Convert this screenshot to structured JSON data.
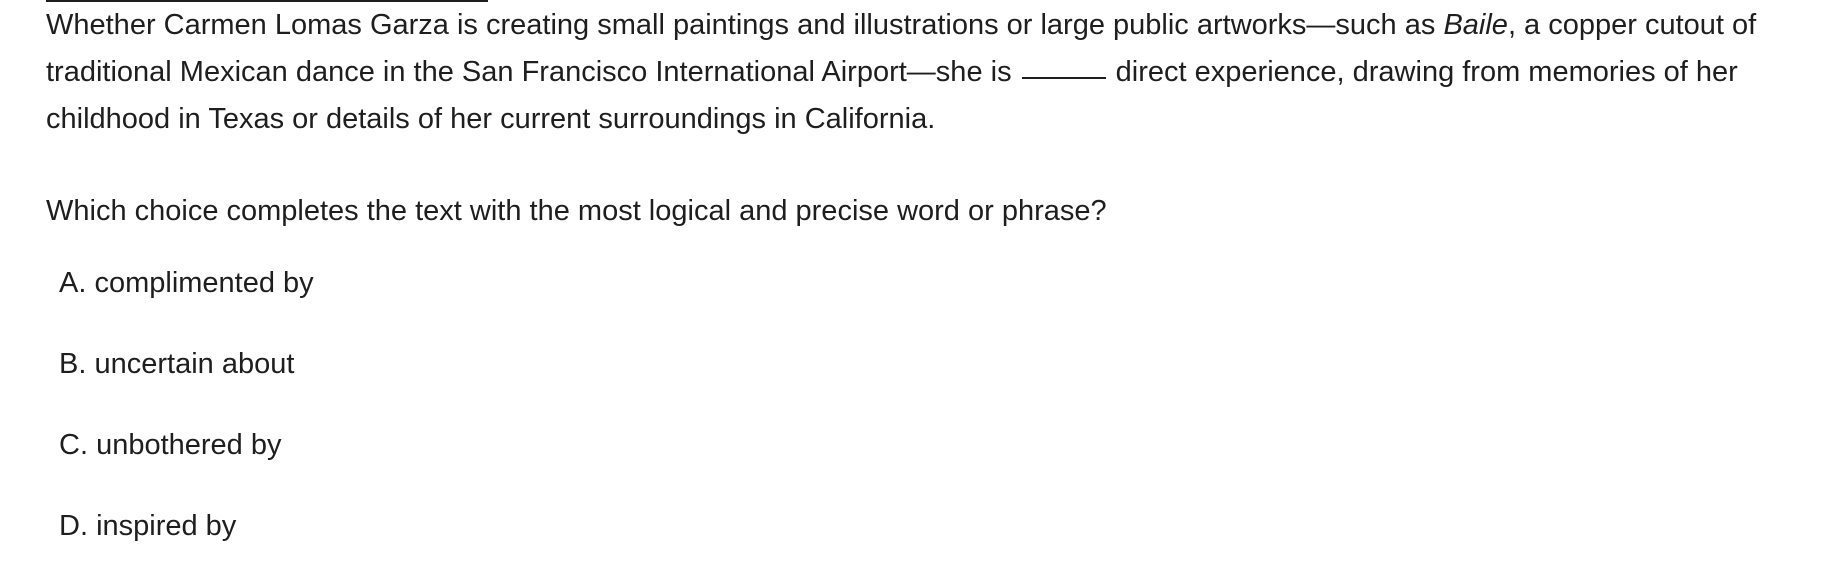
{
  "passage": {
    "part1": "Whether Carmen Lomas Garza is creating small paintings and illustrations or large public artworks—such as ",
    "title_italic": "Baile",
    "part2": ", a copper cutout of traditional Mexican dance in the San Francisco International Airport—she is ",
    "part3": " direct experience, drawing from memories of her childhood in Texas or details of her current surroundings in California."
  },
  "question": "Which choice completes the text with the most logical and precise word or phrase?",
  "choices": [
    {
      "letter": "A.",
      "text": "complimented by"
    },
    {
      "letter": "B.",
      "text": "uncertain about"
    },
    {
      "letter": "C.",
      "text": "unbothered by"
    },
    {
      "letter": "D.",
      "text": "inspired by"
    }
  ]
}
